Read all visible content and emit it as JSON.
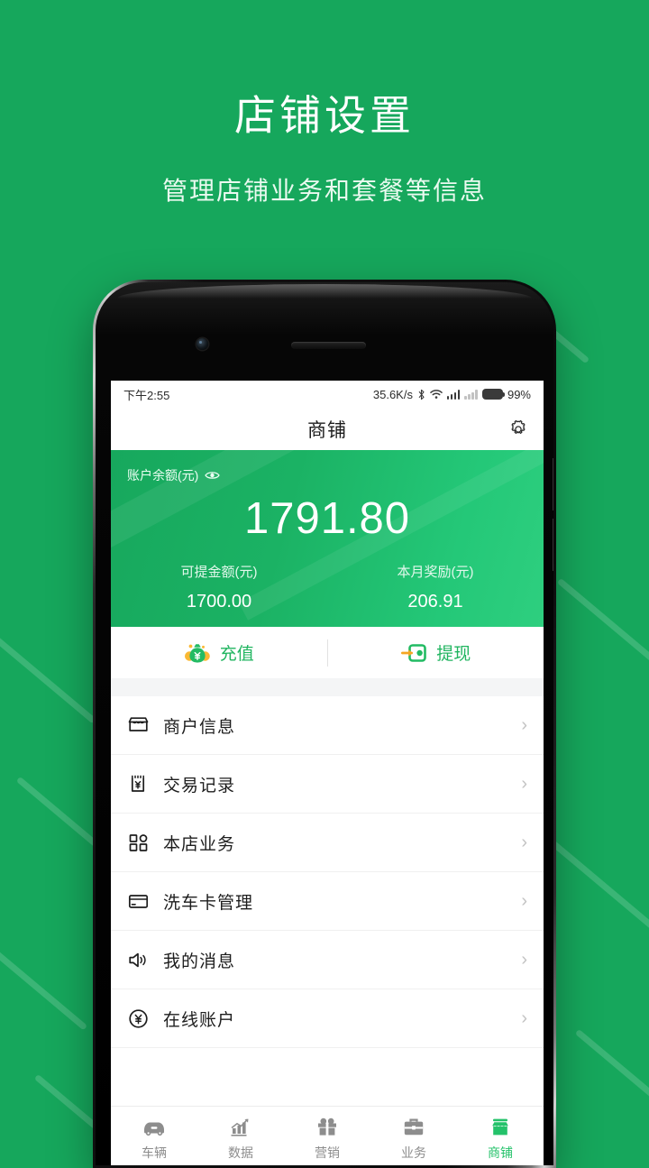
{
  "promo": {
    "title": "店铺设置",
    "subtitle": "管理店铺业务和套餐等信息",
    "bg_color": "#16a75c"
  },
  "statusbar": {
    "time": "下午2:55",
    "net_speed": "35.6K/s",
    "bluetooth_icon": "bluetooth-icon",
    "wifi_icon": "wifi-icon",
    "signal_icon": "signal-bars-icon",
    "signal2_icon": "signal-bars-off-icon",
    "battery_icon": "battery-icon",
    "battery_pct": "99%"
  },
  "appbar": {
    "title": "商铺",
    "settings_icon": "gear-icon"
  },
  "balance": {
    "label": "账户余额(元)",
    "eye_icon": "eye-icon",
    "amount": "1791.80",
    "accent_color": "#1bb264",
    "sub": [
      {
        "label": "可提金额(元)",
        "value": "1700.00"
      },
      {
        "label": "本月奖励(元)",
        "value": "206.91"
      }
    ]
  },
  "actions": [
    {
      "label": "充值",
      "icon": "money-bag-icon",
      "color": "#21b560"
    },
    {
      "label": "提现",
      "icon": "wallet-withdraw-icon",
      "color": "#21b560"
    }
  ],
  "menu": [
    {
      "label": "商户信息",
      "icon": "store-icon",
      "chevron": "›"
    },
    {
      "label": "交易记录",
      "icon": "receipt-yen-icon",
      "chevron": "›"
    },
    {
      "label": "本店业务",
      "icon": "grid-icon",
      "chevron": "›"
    },
    {
      "label": "洗车卡管理",
      "icon": "card-icon",
      "chevron": "›"
    },
    {
      "label": "我的消息",
      "icon": "speaker-icon",
      "chevron": "›"
    },
    {
      "label": "在线账户",
      "icon": "yen-circle-icon",
      "chevron": "›"
    }
  ],
  "tabbar": {
    "active_color": "#24c26a",
    "inactive_color": "#8d8d8d",
    "items": [
      {
        "label": "车辆",
        "icon": "car-icon",
        "active": false
      },
      {
        "label": "数据",
        "icon": "chart-icon",
        "active": false
      },
      {
        "label": "营销",
        "icon": "gift-icon",
        "active": false
      },
      {
        "label": "业务",
        "icon": "briefcase-icon",
        "active": false
      },
      {
        "label": "商铺",
        "icon": "store-filled-icon",
        "active": true
      }
    ]
  }
}
